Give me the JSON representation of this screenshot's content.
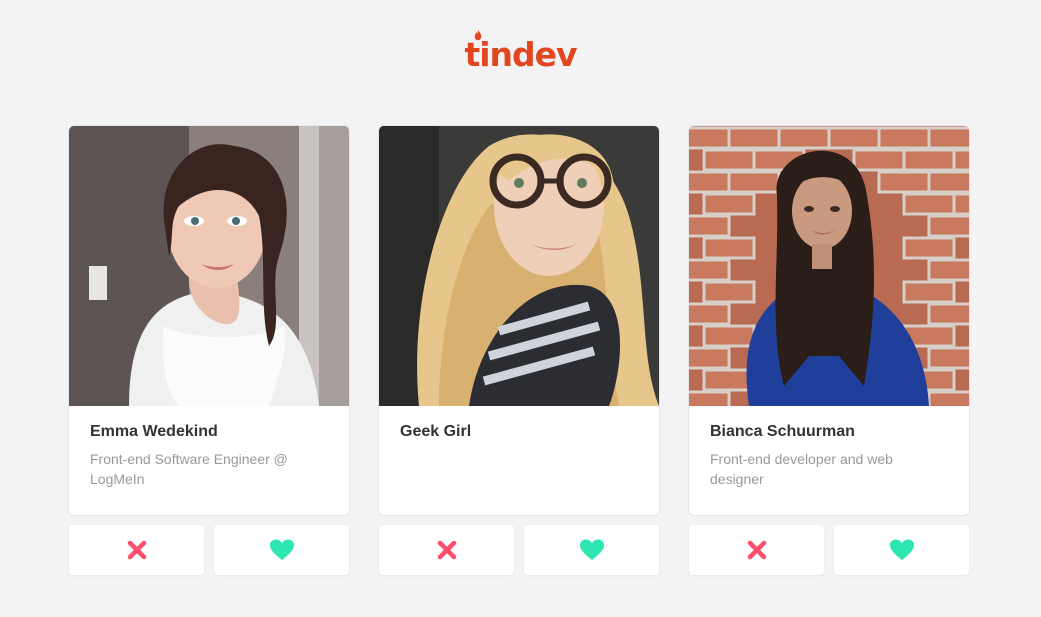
{
  "app": {
    "logo_text": "tindev",
    "brand_color": "#e1461f"
  },
  "colors": {
    "dislike": "#ff4d6a",
    "like": "#2ee6b0"
  },
  "developers": [
    {
      "name": "Emma Wedekind",
      "bio": "Front-end Software Engineer @ LogMeIn",
      "photo_icon": "avatar-photo",
      "dislike_icon": "close-icon",
      "like_icon": "heart-icon"
    },
    {
      "name": "Geek Girl",
      "bio": "",
      "photo_icon": "avatar-photo",
      "dislike_icon": "close-icon",
      "like_icon": "heart-icon"
    },
    {
      "name": "Bianca Schuurman",
      "bio": "Front-end developer and web designer",
      "photo_icon": "avatar-photo",
      "dislike_icon": "close-icon",
      "like_icon": "heart-icon"
    }
  ]
}
